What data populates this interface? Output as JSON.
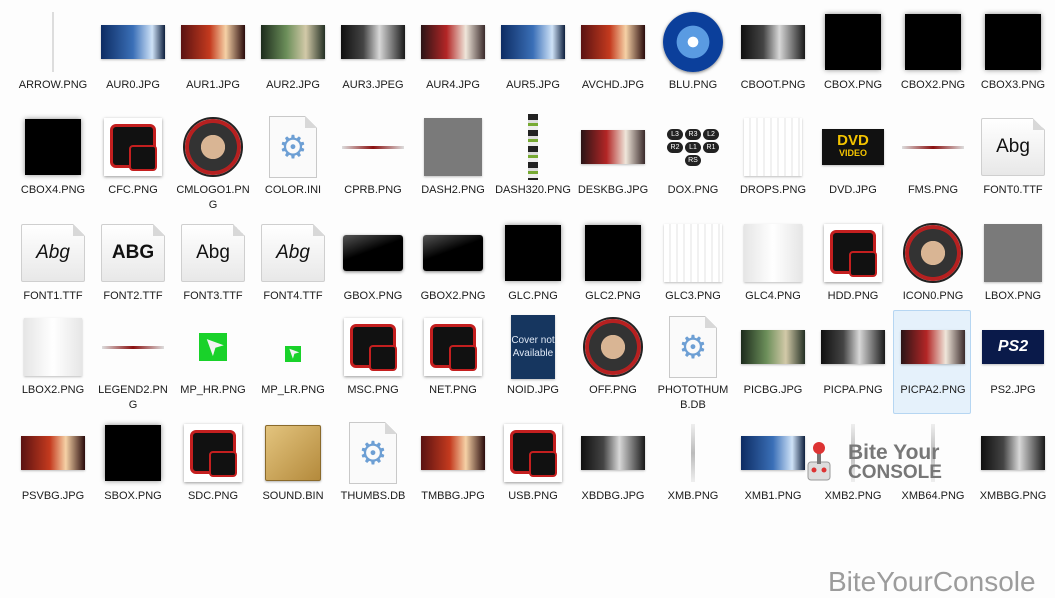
{
  "files": [
    {
      "name": "ARROW.PNG",
      "icon": "thin-line"
    },
    {
      "name": "AUR0.JPG",
      "icon": "banner-photo"
    },
    {
      "name": "AUR1.JPG",
      "icon": "banner-photo"
    },
    {
      "name": "AUR2.JPG",
      "icon": "banner-photo"
    },
    {
      "name": "AUR3.JPEG",
      "icon": "banner-photo"
    },
    {
      "name": "AUR4.JPG",
      "icon": "banner-photo"
    },
    {
      "name": "AUR5.JPG",
      "icon": "banner-photo"
    },
    {
      "name": "AVCHD.JPG",
      "icon": "banner-photo"
    },
    {
      "name": "BLU.PNG",
      "icon": "bluray-disc"
    },
    {
      "name": "CBOOT.PNG",
      "icon": "banner-photo"
    },
    {
      "name": "CBOX.PNG",
      "icon": "black-square"
    },
    {
      "name": "CBOX2.PNG",
      "icon": "black-square"
    },
    {
      "name": "CBOX3.PNG",
      "icon": "black-square"
    },
    {
      "name": "CBOX4.PNG",
      "icon": "black-square"
    },
    {
      "name": "CFC.PNG",
      "icon": "red-frame"
    },
    {
      "name": "CMLOGO1.PNG",
      "icon": "character-badge"
    },
    {
      "name": "COLOR.INI",
      "icon": "settings-doc"
    },
    {
      "name": "CPRB.PNG",
      "icon": "thin-line"
    },
    {
      "name": "DASH2.PNG",
      "icon": "gray-square"
    },
    {
      "name": "DASH320.PNG",
      "icon": "tall-strip"
    },
    {
      "name": "DESKBG.JPG",
      "icon": "banner-photo"
    },
    {
      "name": "DOX.PNG",
      "icon": "button-glyphs"
    },
    {
      "name": "DROPS.PNG",
      "icon": "white-square"
    },
    {
      "name": "DVD.JPG",
      "icon": "dvd-logo"
    },
    {
      "name": "FMS.PNG",
      "icon": "thin-line"
    },
    {
      "name": "FONT0.TTF",
      "icon": "font-file"
    },
    {
      "name": "FONT1.TTF",
      "icon": "font-file"
    },
    {
      "name": "FONT2.TTF",
      "icon": "font-file"
    },
    {
      "name": "FONT3.TTF",
      "icon": "font-file"
    },
    {
      "name": "FONT4.TTF",
      "icon": "font-file"
    },
    {
      "name": "GBOX.PNG",
      "icon": "black-bar"
    },
    {
      "name": "GBOX2.PNG",
      "icon": "black-bar"
    },
    {
      "name": "GLC.PNG",
      "icon": "black-square"
    },
    {
      "name": "GLC2.PNG",
      "icon": "black-square"
    },
    {
      "name": "GLC3.PNG",
      "icon": "white-square"
    },
    {
      "name": "GLC4.PNG",
      "icon": "gray-square"
    },
    {
      "name": "HDD.PNG",
      "icon": "red-frame"
    },
    {
      "name": "ICON0.PNG",
      "icon": "character-badge"
    },
    {
      "name": "LBOX.PNG",
      "icon": "gray-square"
    },
    {
      "name": "LBOX2.PNG",
      "icon": "gray-square"
    },
    {
      "name": "LEGEND2.PNG",
      "icon": "thin-line"
    },
    {
      "name": "MP_HR.PNG",
      "icon": "cursor-green"
    },
    {
      "name": "MP_LR.PNG",
      "icon": "cursor-green-small"
    },
    {
      "name": "MSC.PNG",
      "icon": "red-frame"
    },
    {
      "name": "NET.PNG",
      "icon": "red-frame"
    },
    {
      "name": "NOID.JPG",
      "icon": "cover-not-available"
    },
    {
      "name": "OFF.PNG",
      "icon": "character-badge"
    },
    {
      "name": "PHOTOTHUMB.DB",
      "icon": "settings-doc"
    },
    {
      "name": "PICBG.JPG",
      "icon": "banner-photo"
    },
    {
      "name": "PICPA.PNG",
      "icon": "banner-photo"
    },
    {
      "name": "PICPA2.PNG",
      "icon": "banner-photo",
      "selected": true
    },
    {
      "name": "PS2.JPG",
      "icon": "ps2-logo"
    },
    {
      "name": "PSVBG.JPG",
      "icon": "banner-photo"
    },
    {
      "name": "SBOX.PNG",
      "icon": "black-square"
    },
    {
      "name": "SDC.PNG",
      "icon": "red-frame"
    },
    {
      "name": "SOUND.BIN",
      "icon": "package-box"
    },
    {
      "name": "THUMBS.DB",
      "icon": "settings-doc"
    },
    {
      "name": "TMBBG.JPG",
      "icon": "banner-photo"
    },
    {
      "name": "USB.PNG",
      "icon": "red-frame"
    },
    {
      "name": "XBDBG.JPG",
      "icon": "banner-photo"
    },
    {
      "name": "XMB.PNG",
      "icon": "thin-vertical"
    },
    {
      "name": "XMB1.PNG",
      "icon": "banner-photo"
    },
    {
      "name": "XMB2.PNG",
      "icon": "thin-vertical"
    },
    {
      "name": "XMB64.PNG",
      "icon": "thin-vertical"
    },
    {
      "name": "XMBBG.PNG",
      "icon": "banner-photo"
    }
  ],
  "thumb_text": {
    "font_sample": "Abg",
    "font_sample_caps": "ABG",
    "cover_not_available": "Cover not Available",
    "dvd_logo": "DVD",
    "dvd_logo_sub": "VIDEO",
    "ps2_logo": "PS2",
    "dox_glyphs": [
      "L3",
      "R3",
      "L2",
      "R2",
      "L1",
      "R1",
      "RS"
    ]
  },
  "watermark": {
    "logo_line1": "Bite Your",
    "logo_line2": "CONSOLE",
    "text": "BiteYourConsole"
  },
  "colors": {
    "selection_bg": "#e5f1fb",
    "selection_border": "#b6d6f2",
    "accent_red": "#c41f1f",
    "label_text": "#1b1b1b"
  }
}
